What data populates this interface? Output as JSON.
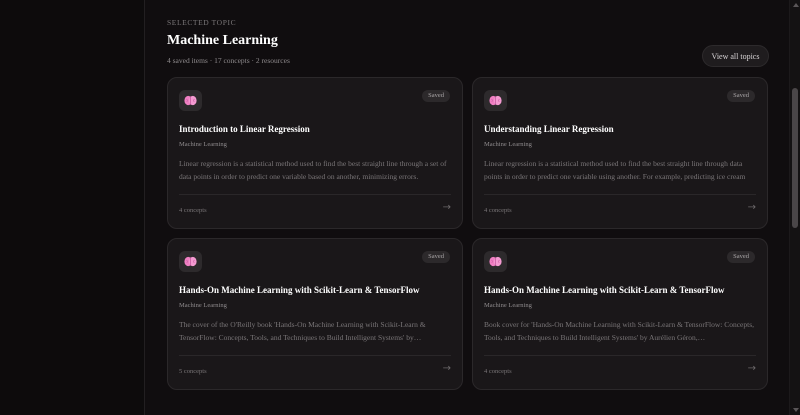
{
  "header": {
    "eyebrow": "SELECTED TOPIC",
    "title": "Machine Learning",
    "meta": "4 saved items · 17 concepts · 2 resources",
    "view_all_label": "View all topics"
  },
  "colors": {
    "background": "#100d0f",
    "card": "#1a1719",
    "brain_icon": "#f07fc3"
  },
  "cards": [
    {
      "icon": "brain-icon",
      "badge": "Saved",
      "title": "Introduction to Linear Regression",
      "category": "Machine Learning",
      "description": "Linear regression is a statistical method used to find the best straight line through a set of data points in order to predict one variable based on another, minimizing errors.",
      "concepts": "4 concepts",
      "arrow": "→"
    },
    {
      "icon": "brain-icon",
      "badge": "Saved",
      "title": "Understanding Linear Regression",
      "category": "Machine Learning",
      "description": "Linear regression is a statistical method used to find the best straight line through data points in order to predict one variable using another. For example, predicting ice cream sales…",
      "concepts": "4 concepts",
      "arrow": "→"
    },
    {
      "icon": "brain-icon",
      "badge": "Saved",
      "title": "Hands-On Machine Learning with Scikit-Learn & TensorFlow",
      "category": "Machine Learning",
      "description": "The cover of the O'Reilly book 'Hands-On Machine Learning with Scikit-Learn & TensorFlow: Concepts, Tools, and Techniques to Build Intelligent Systems' by…",
      "concepts": "5 concepts",
      "arrow": "→"
    },
    {
      "icon": "brain-icon",
      "badge": "Saved",
      "title": "Hands-On Machine Learning with Scikit-Learn & TensorFlow",
      "category": "Machine Learning",
      "description": "Book cover for 'Hands-On Machine Learning with Scikit-Learn & TensorFlow: Concepts, Tools, and Techniques to Build Intelligent Systems' by Aurélien Géron,…",
      "concepts": "4 concepts",
      "arrow": "→"
    }
  ]
}
